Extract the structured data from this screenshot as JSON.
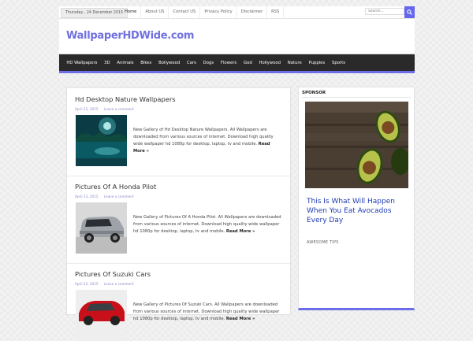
{
  "topbar": {
    "date": "Thursday , 24 December 2015",
    "links": [
      "Home",
      "About US",
      "Contact US",
      "Privacy Policy",
      "Disclaimer",
      "RSS"
    ],
    "search_placeholder": "Search..."
  },
  "header": {
    "logo": "WallpaperHDWide.com"
  },
  "nav": {
    "items": [
      "HD Wallpapers",
      "3D",
      "Animals",
      "Bikes",
      "Bollywood",
      "Cars",
      "Dogs",
      "Flowers",
      "God",
      "Hollywood",
      "Nature",
      "Puppies",
      "Sports"
    ]
  },
  "posts": [
    {
      "title": "Hd Desktop Nature Wallpapers",
      "date": "April 23, 2015",
      "comment": "Leave a comment",
      "excerpt": "New Gallery of Hd Desktop Nature Wallpapers. All Wallpapers are downloaded from various sources of internet. Download high quality wide wallpaper hd 1080p for desktop, laptop, tv and mobile.",
      "more": "Read More »"
    },
    {
      "title": "Pictures Of A Honda Pilot",
      "date": "April 23, 2015",
      "comment": "Leave a comment",
      "excerpt": "New Gallery of Pictures Of A Honda Pilot. All Wallpapers are downloaded from various sources of internet. Download high quality wide wallpaper hd 1080p for desktop, laptop, tv and mobile.",
      "more": "Read More »"
    },
    {
      "title": "Pictures Of Suzuki Cars",
      "date": "April 23, 2015",
      "comment": "Leave a comment",
      "excerpt": "New Gallery of Pictures Of Suzuki Cars. All Wallpapers are downloaded from various sources of internet. Download high quality wide wallpaper hd 1080p for desktop, laptop, tv and mobile.",
      "more": "Read More »"
    }
  ],
  "sidebar": {
    "title": "SPONSOR",
    "ad_headline": "This Is What Will Happen When You Eat Avocados Every Day",
    "ad_source": "AWESOME TIPS"
  },
  "colors": {
    "accent": "#6d6dea",
    "logo": "#7070e0",
    "nav_bg": "#2a2a2a",
    "ad_link": "#1e3bb8"
  }
}
